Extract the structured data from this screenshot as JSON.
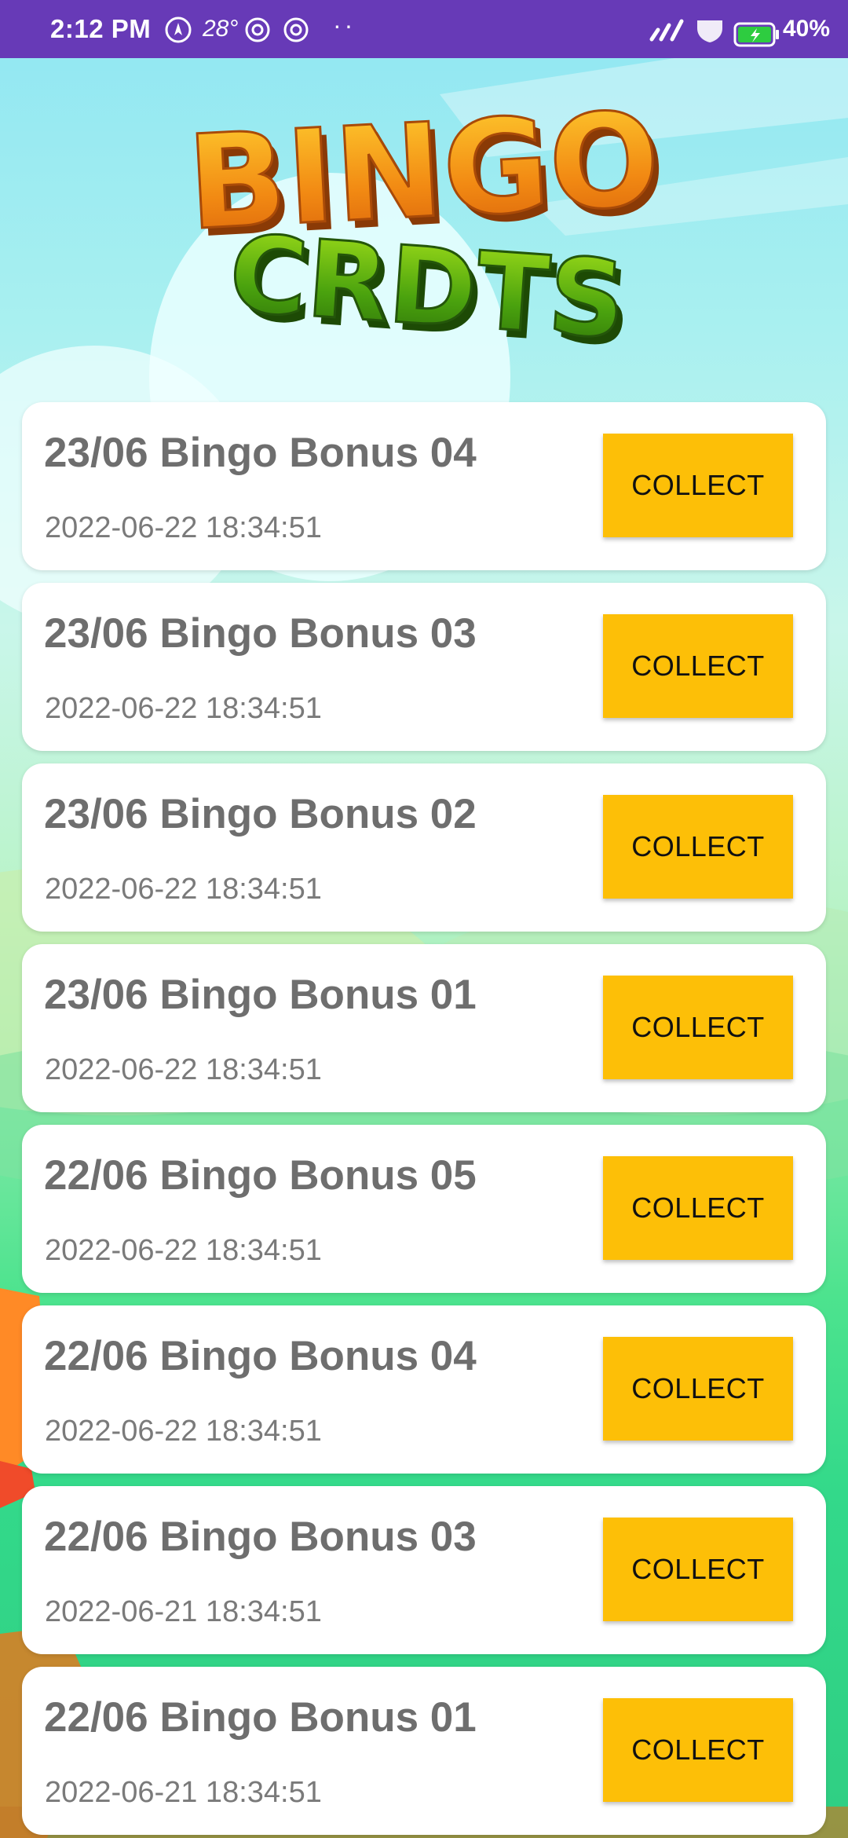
{
  "status_bar": {
    "time": "2:12 PM",
    "temperature": "28°",
    "overflow": "··",
    "battery": "40%",
    "icons": [
      "navigation-icon",
      "at-sign-icon",
      "at-sign-icon",
      "signal-icon",
      "shield-icon",
      "battery-charging-icon"
    ]
  },
  "logo": {
    "line1": "BINGO",
    "line2": "CRDTS"
  },
  "theme": {
    "status_bar_color": "#673ab7",
    "button_color": "#fdbf07",
    "card_color": "#ffffff",
    "title_color": "#6e6e6e"
  },
  "rewards": [
    {
      "title": "23/06 Bingo Bonus 04",
      "date": "2022-06-22 18:34:51",
      "button": "COLLECT"
    },
    {
      "title": "23/06 Bingo Bonus 03",
      "date": "2022-06-22 18:34:51",
      "button": "COLLECT"
    },
    {
      "title": "23/06 Bingo Bonus 02",
      "date": "2022-06-22 18:34:51",
      "button": "COLLECT"
    },
    {
      "title": "23/06 Bingo Bonus 01",
      "date": "2022-06-22 18:34:51",
      "button": "COLLECT"
    },
    {
      "title": "22/06 Bingo Bonus 05",
      "date": "2022-06-22 18:34:51",
      "button": "COLLECT"
    },
    {
      "title": "22/06 Bingo Bonus 04",
      "date": "2022-06-22 18:34:51",
      "button": "COLLECT"
    },
    {
      "title": "22/06 Bingo Bonus 03",
      "date": "2022-06-21 18:34:51",
      "button": "COLLECT"
    },
    {
      "title": "22/06 Bingo Bonus 01",
      "date": "2022-06-21 18:34:51",
      "button": "COLLECT"
    }
  ]
}
